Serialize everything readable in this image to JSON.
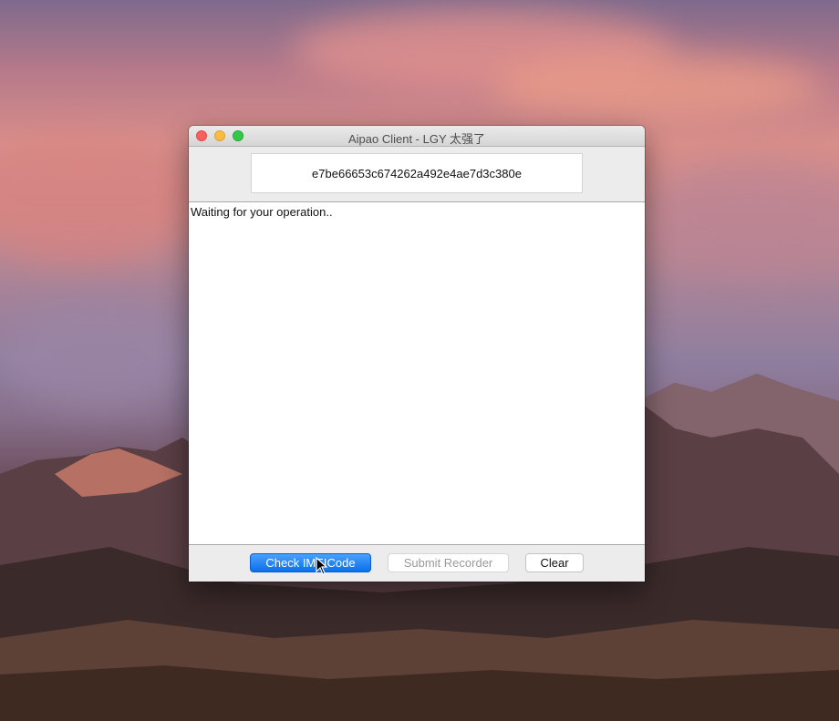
{
  "window": {
    "title": "Aipao Client - LGY 太强了"
  },
  "code_field": {
    "value": "e7be66653c674262a492e4ae7d3c380e"
  },
  "log": {
    "text": "Waiting for your operation.."
  },
  "buttons": {
    "check_label": "Check IMEICode",
    "submit_label": "Submit Recorder",
    "clear_label": "Clear"
  },
  "colors": {
    "accent": "#0a6fe8",
    "close": "#fc605c",
    "minimize": "#fdbc40",
    "zoom": "#34c84a"
  }
}
